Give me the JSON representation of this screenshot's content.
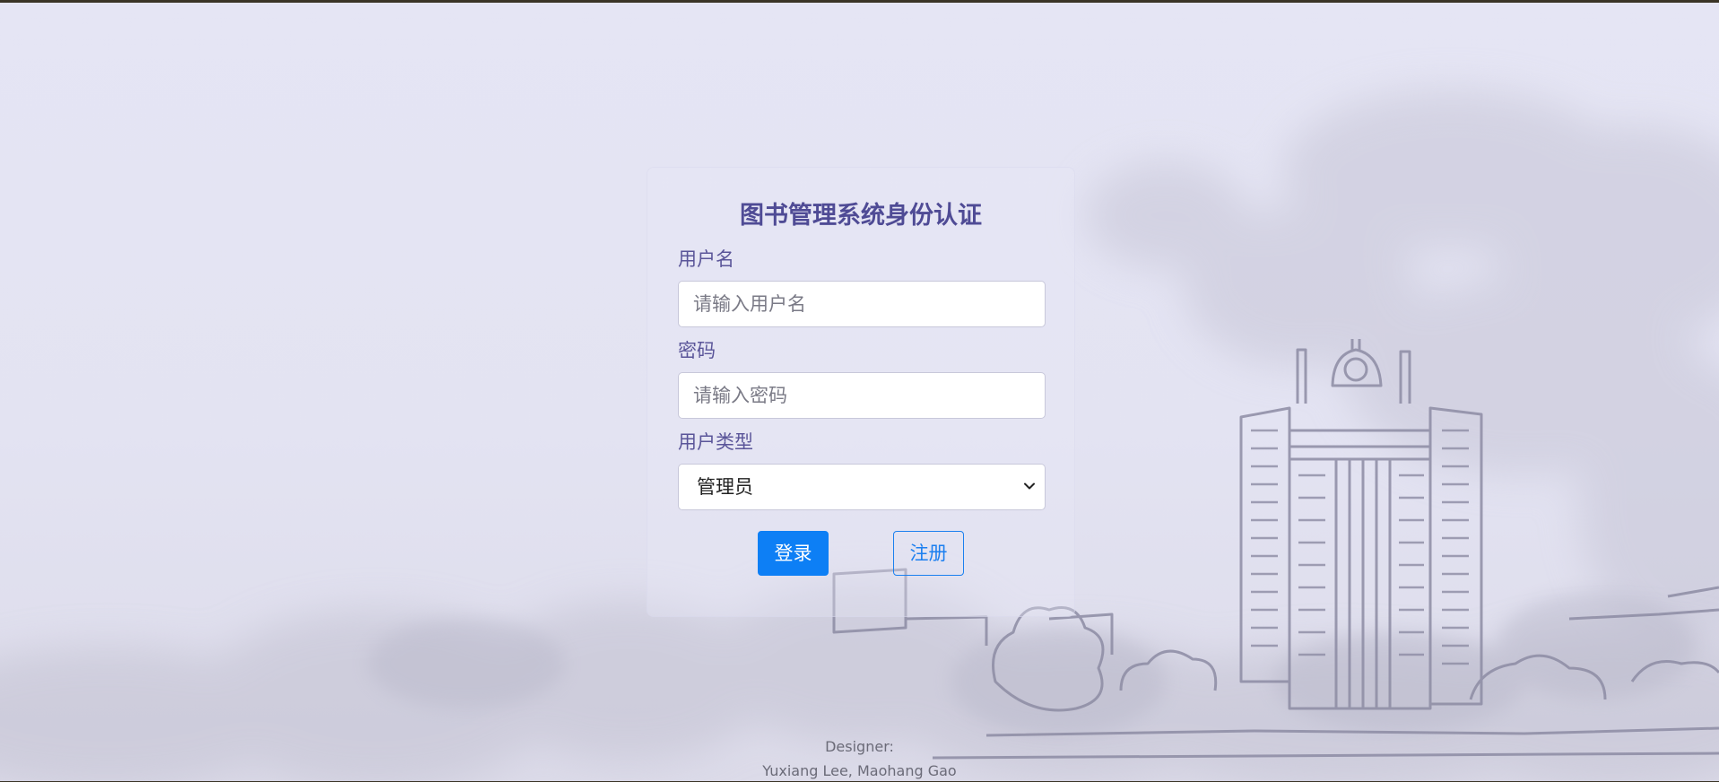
{
  "login": {
    "title": "图书管理系统身份认证",
    "username_label": "用户名",
    "username_placeholder": "请输入用户名",
    "username_value": "",
    "password_label": "密码",
    "password_placeholder": "请输入密码",
    "password_value": "",
    "user_type_label": "用户类型",
    "user_type_selected": "管理员",
    "login_button": "登录",
    "register_button": "注册"
  },
  "footer": {
    "designer_label": "Designer:",
    "designers": "Yuxiang Lee, Maohang Gao"
  },
  "colors": {
    "title": "#4f4b95",
    "label": "#5a5599",
    "primary": "#0d7ff5",
    "background": "#e5e5f4"
  },
  "icons": {
    "select_arrow": "chevron-down-icon"
  }
}
